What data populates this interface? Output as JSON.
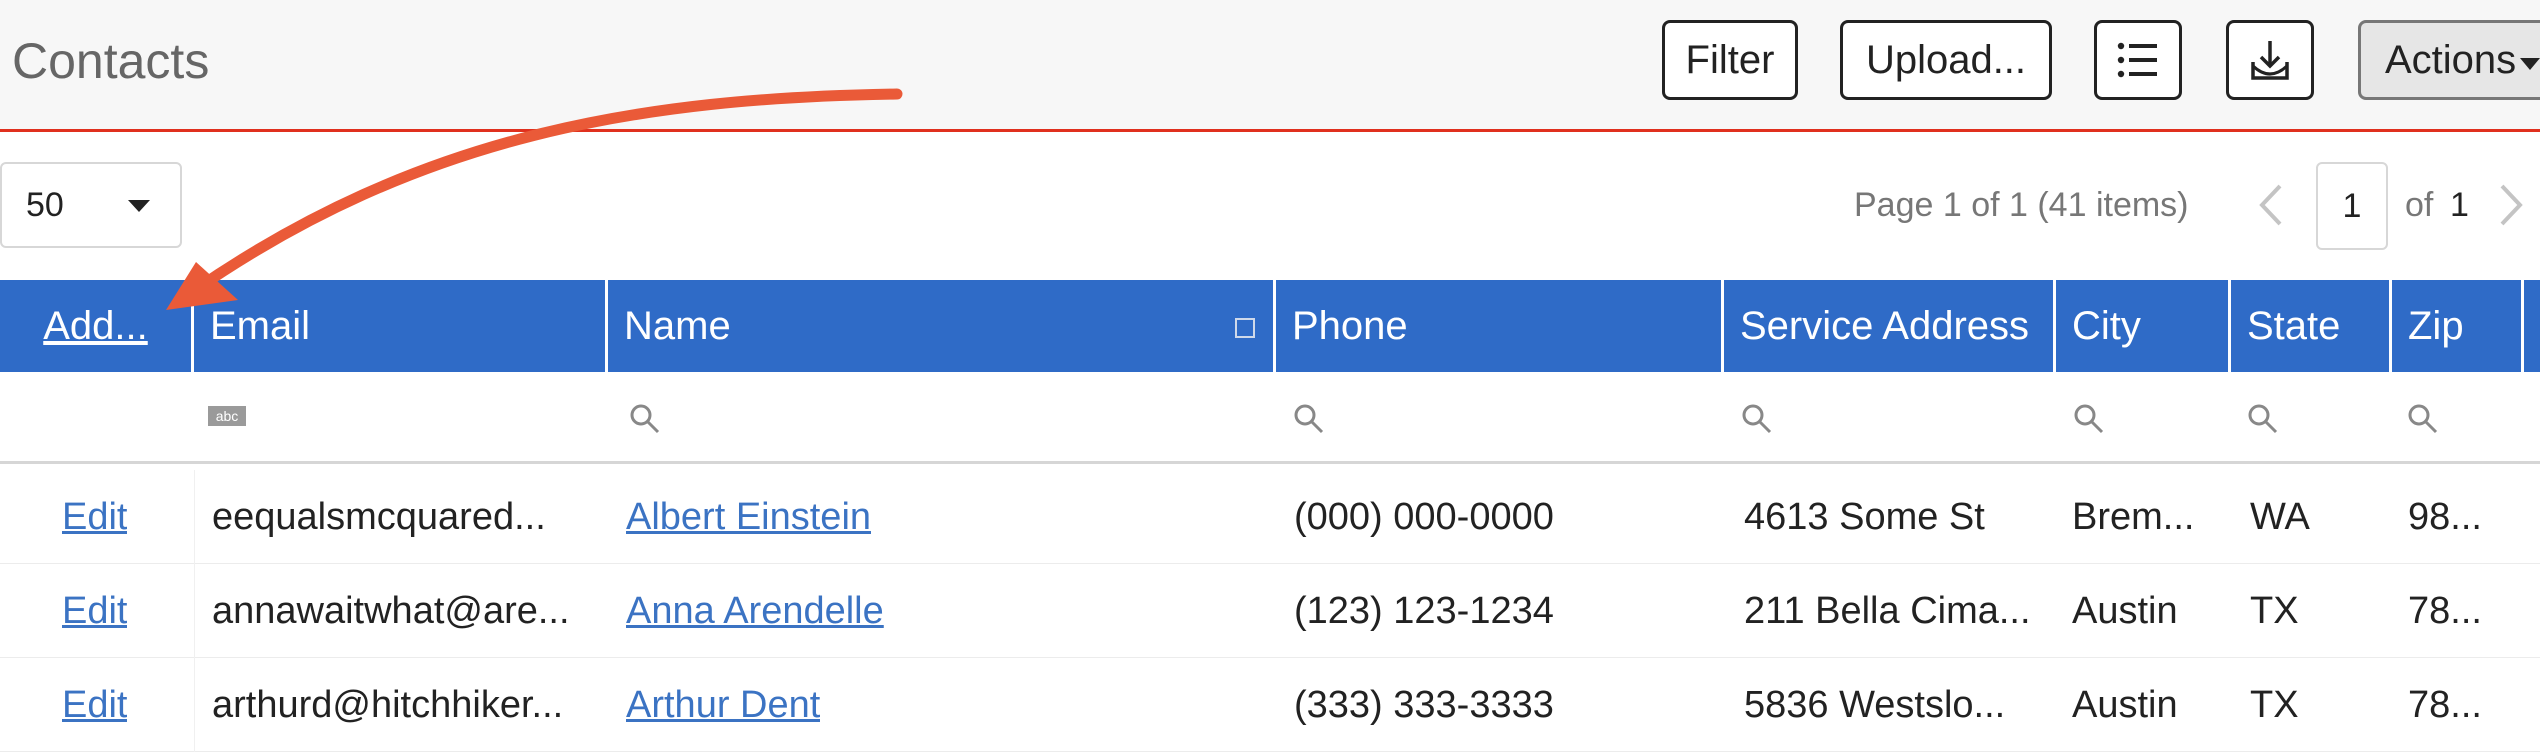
{
  "header": {
    "title": "Contacts",
    "filter_label": "Filter",
    "upload_label": "Upload...",
    "actions_label": "Actions",
    "list_icon": "list-icon",
    "download_icon": "download-icon"
  },
  "pager": {
    "page_size": "50",
    "info": "Page 1 of 1 (41 items)",
    "current_page": "1",
    "of_label": "of",
    "total_pages": "1"
  },
  "grid": {
    "add_label": "Add...",
    "columns": [
      "Email",
      "Name",
      "Phone",
      "Service Address",
      "City",
      "State",
      "Zip"
    ],
    "filter_text_icon": "abc",
    "rows": [
      {
        "action": "Edit",
        "email": "eequalsmcquared...",
        "name": "Albert Einstein",
        "phone": "(000) 000-0000",
        "address": "4613 Some St",
        "city": "Brem...",
        "state": "WA",
        "zip": "98..."
      },
      {
        "action": "Edit",
        "email": "annawaitwhat@are...",
        "name": "Anna Arendelle",
        "phone": "(123) 123-1234",
        "address": "211 Bella Cima...",
        "city": "Austin",
        "state": "TX",
        "zip": "78..."
      },
      {
        "action": "Edit",
        "email": "arthurd@hitchhiker...",
        "name": "Arthur Dent",
        "phone": "(333) 333-3333",
        "address": "5836 Westslo...",
        "city": "Austin",
        "state": "TX",
        "zip": "78..."
      }
    ]
  },
  "colors": {
    "accent": "#2f6bc7",
    "header_border": "#e0301e",
    "annotation_arrow": "#ea5a38",
    "link": "#3b73c3"
  }
}
